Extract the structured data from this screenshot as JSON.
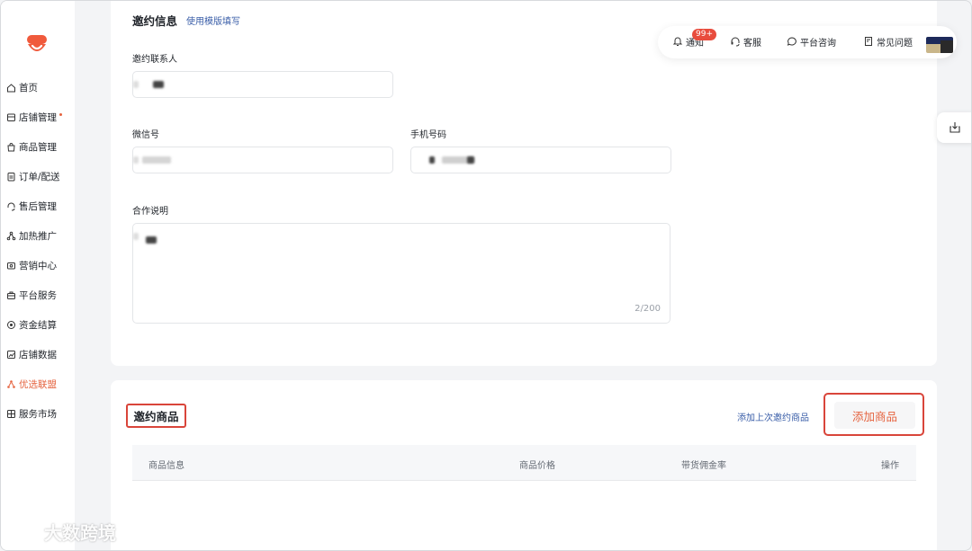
{
  "sidebar": {
    "items": [
      {
        "label": "首页",
        "icon": "home-icon"
      },
      {
        "label": "店铺管理",
        "icon": "store-icon",
        "dot": true
      },
      {
        "label": "商品管理",
        "icon": "bag-icon"
      },
      {
        "label": "订单/配送",
        "icon": "order-icon"
      },
      {
        "label": "售后管理",
        "icon": "headset-icon"
      },
      {
        "label": "加热推广",
        "icon": "share-icon"
      },
      {
        "label": "营销中心",
        "icon": "marketing-icon"
      },
      {
        "label": "平台服务",
        "icon": "service-icon"
      },
      {
        "label": "资金结算",
        "icon": "money-icon"
      },
      {
        "label": "店铺数据",
        "icon": "chart-icon"
      },
      {
        "label": "优选联盟",
        "icon": "alliance-icon",
        "active": true
      },
      {
        "label": "服务市场",
        "icon": "market-icon"
      }
    ]
  },
  "topbar": {
    "notice_label": "通知",
    "notice_badge": "99+",
    "service_label": "客服",
    "consult_label": "平台咨询",
    "faq_label": "常见问题"
  },
  "invite_info": {
    "title": "邀约信息",
    "template_link": "使用模版填写",
    "contact_label": "邀约联系人",
    "wechat_label": "微信号",
    "phone_label": "手机号码",
    "desc_label": "合作说明",
    "desc_counter": "2/200"
  },
  "invite_products": {
    "title": "邀约商品",
    "add_last_link": "添加上次邀约商品",
    "add_button": "添加商品",
    "columns": [
      "商品信息",
      "商品价格",
      "带货佣金率",
      "操作"
    ]
  },
  "watermark": "大数跨境",
  "colors": {
    "accent": "#e5633f",
    "highlight_border": "#d9453a",
    "link": "#3a5ea8",
    "badge": "#e84c3d"
  }
}
